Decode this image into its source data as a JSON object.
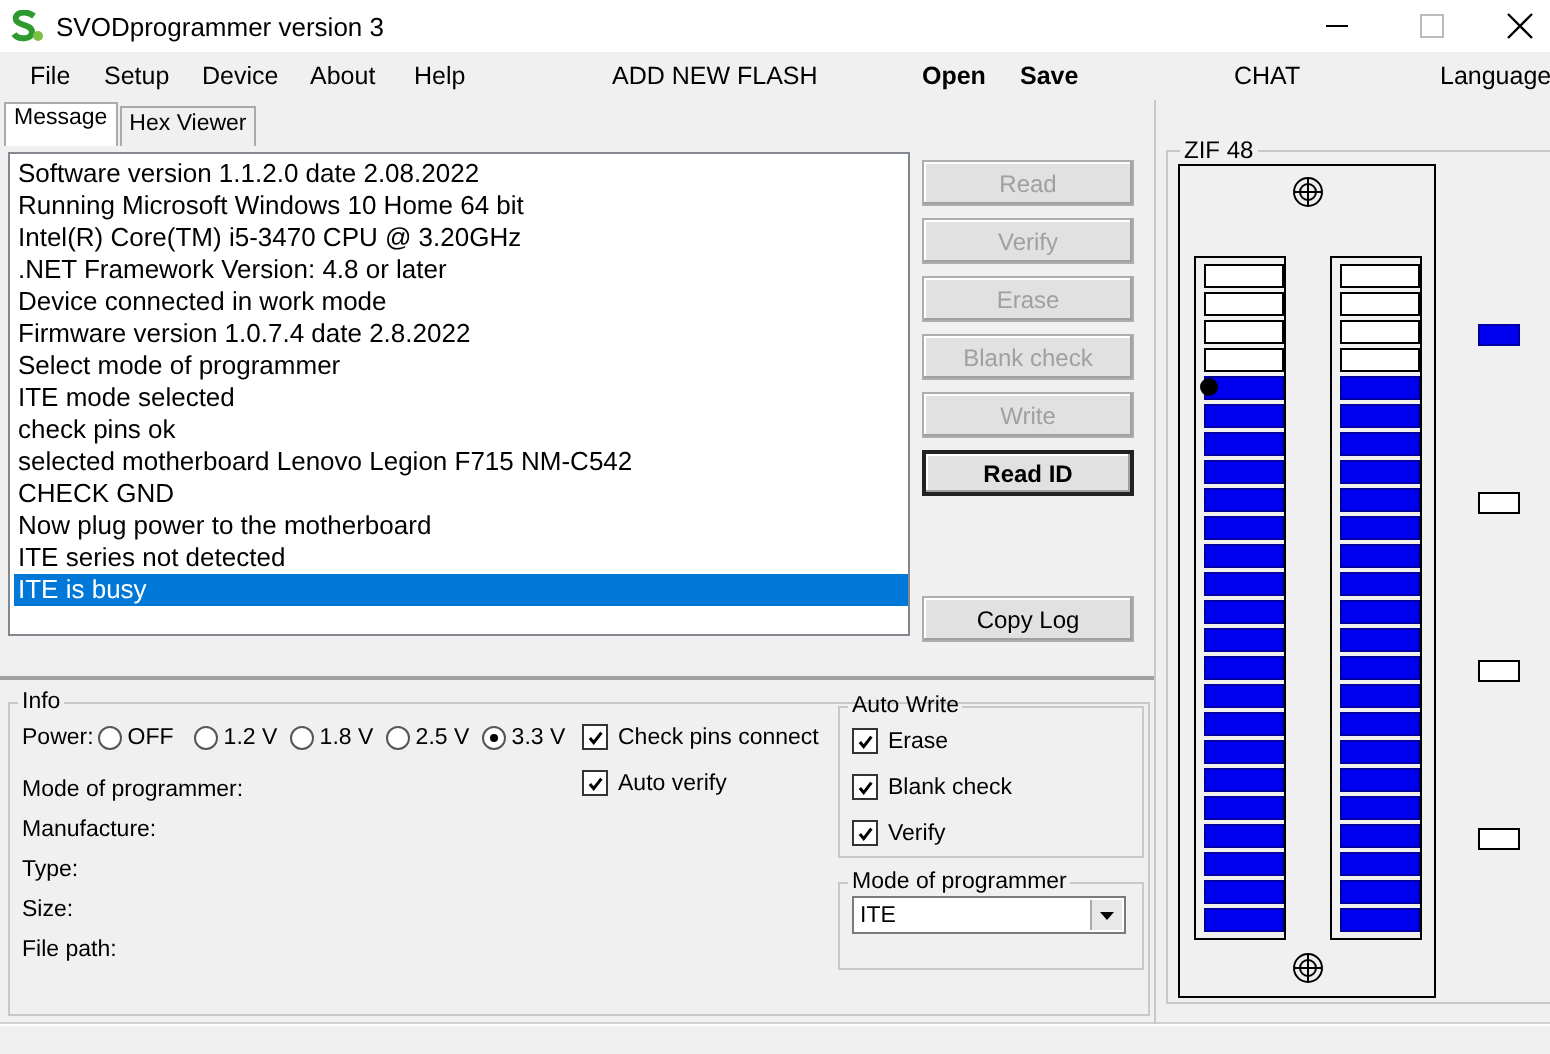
{
  "window": {
    "title": "SVODprogrammer version 3"
  },
  "menu": [
    {
      "label": "File",
      "bold": false
    },
    {
      "label": "Setup",
      "bold": false
    },
    {
      "label": "Device",
      "bold": false
    },
    {
      "label": "About",
      "bold": false
    },
    {
      "label": "Help",
      "bold": false
    },
    {
      "label": "ADD NEW FLASH",
      "bold": false
    },
    {
      "label": "Open",
      "bold": true
    },
    {
      "label": "Save",
      "bold": true
    },
    {
      "label": "CHAT",
      "bold": false
    },
    {
      "label": "Language",
      "bold": false
    }
  ],
  "tabs": [
    {
      "label": "Message",
      "selected": true
    },
    {
      "label": "Hex Viewer",
      "selected": false
    }
  ],
  "log": [
    {
      "text": "Software version 1.1.2.0 date 2.08.2022",
      "selected": false
    },
    {
      "text": "Running Microsoft Windows 10 Home 64 bit",
      "selected": false
    },
    {
      "text": "Intel(R) Core(TM) i5-3470 CPU @ 3.20GHz",
      "selected": false
    },
    {
      "text": ".NET Framework Version: 4.8 or later",
      "selected": false
    },
    {
      "text": "Device connected in work mode",
      "selected": false
    },
    {
      "text": "Firmware version 1.0.7.4 date 2.8.2022",
      "selected": false
    },
    {
      "text": "Select mode of programmer",
      "selected": false
    },
    {
      "text": "ITE mode selected",
      "selected": false
    },
    {
      "text": "check pins ok",
      "selected": false
    },
    {
      "text": "selected motherboard Lenovo Legion F715 NM-C542",
      "selected": false
    },
    {
      "text": "CHECK GND",
      "selected": false
    },
    {
      "text": "Now plug power to the motherboard",
      "selected": false
    },
    {
      "text": "ITE series not detected",
      "selected": false
    },
    {
      "text": "ITE is busy",
      "selected": true
    }
  ],
  "actions": [
    {
      "label": "Read",
      "disabled": true,
      "default": false
    },
    {
      "label": "Verify",
      "disabled": true,
      "default": false
    },
    {
      "label": "Erase",
      "disabled": true,
      "default": false
    },
    {
      "label": "Blank check",
      "disabled": true,
      "default": false
    },
    {
      "label": "Write",
      "disabled": true,
      "default": false
    },
    {
      "label": "Read ID",
      "disabled": false,
      "default": true
    }
  ],
  "copy_button": {
    "label": "Copy Log"
  },
  "info": {
    "title": "Info",
    "power": {
      "label": "Power:",
      "options": [
        {
          "label": "OFF",
          "selected": false
        },
        {
          "label": "1.2 V",
          "selected": false
        },
        {
          "label": "1.8 V",
          "selected": false
        },
        {
          "label": "2.5 V",
          "selected": false
        },
        {
          "label": "3.3 V",
          "selected": true
        }
      ]
    },
    "fields": [
      "Mode of programmer:",
      "Manufacture:",
      "Type:",
      "Size:",
      "File path:"
    ],
    "options": [
      {
        "label": "Check pins connect",
        "checked": true
      },
      {
        "label": "Auto verify",
        "checked": true
      }
    ],
    "auto_write": {
      "title": "Auto Write",
      "options": [
        {
          "label": "Erase",
          "checked": true
        },
        {
          "label": "Blank check",
          "checked": true
        },
        {
          "label": "Verify",
          "checked": true
        }
      ]
    },
    "mode": {
      "title": "Mode of programmer",
      "value": "ITE"
    }
  },
  "zif": {
    "title": "ZIF 48",
    "left_pins": [
      {
        "on": false,
        "marker": false
      },
      {
        "on": false,
        "marker": false
      },
      {
        "on": false,
        "marker": false
      },
      {
        "on": false,
        "marker": false
      },
      {
        "on": true,
        "marker": true
      },
      {
        "on": true,
        "marker": false
      },
      {
        "on": true,
        "marker": false
      },
      {
        "on": true,
        "marker": false
      },
      {
        "on": true,
        "marker": false
      },
      {
        "on": true,
        "marker": false
      },
      {
        "on": true,
        "marker": false
      },
      {
        "on": true,
        "marker": false
      },
      {
        "on": true,
        "marker": false
      },
      {
        "on": true,
        "marker": false
      },
      {
        "on": true,
        "marker": false
      },
      {
        "on": true,
        "marker": false
      },
      {
        "on": true,
        "marker": false
      },
      {
        "on": true,
        "marker": false
      },
      {
        "on": true,
        "marker": false
      },
      {
        "on": true,
        "marker": false
      },
      {
        "on": true,
        "marker": false
      },
      {
        "on": true,
        "marker": false
      },
      {
        "on": true,
        "marker": false
      },
      {
        "on": true,
        "marker": false
      }
    ],
    "right_pins": [
      {
        "on": false,
        "marker": false
      },
      {
        "on": false,
        "marker": false
      },
      {
        "on": false,
        "marker": false
      },
      {
        "on": false,
        "marker": false
      },
      {
        "on": true,
        "marker": false
      },
      {
        "on": true,
        "marker": false
      },
      {
        "on": true,
        "marker": false
      },
      {
        "on": true,
        "marker": false
      },
      {
        "on": true,
        "marker": false
      },
      {
        "on": true,
        "marker": false
      },
      {
        "on": true,
        "marker": false
      },
      {
        "on": true,
        "marker": false
      },
      {
        "on": true,
        "marker": false
      },
      {
        "on": true,
        "marker": false
      },
      {
        "on": true,
        "marker": false
      },
      {
        "on": true,
        "marker": false
      },
      {
        "on": true,
        "marker": false
      },
      {
        "on": true,
        "marker": false
      },
      {
        "on": true,
        "marker": false
      },
      {
        "on": true,
        "marker": false
      },
      {
        "on": true,
        "marker": false
      },
      {
        "on": true,
        "marker": false
      },
      {
        "on": true,
        "marker": false
      },
      {
        "on": true,
        "marker": false
      }
    ],
    "indicators": [
      {
        "on": true
      },
      {
        "on": false
      },
      {
        "on": false
      },
      {
        "on": false
      }
    ]
  }
}
